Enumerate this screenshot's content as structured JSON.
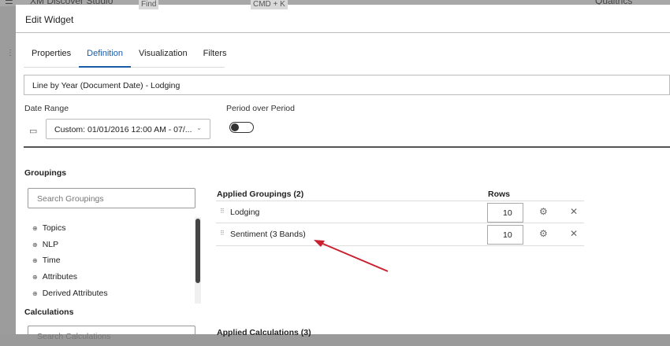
{
  "background_app": {
    "title": "XM Discover Studio",
    "find": "Find",
    "shortcut": "CMD + K",
    "org": "Qualtrics"
  },
  "modal": {
    "title": "Edit Widget",
    "tabs": [
      {
        "label": "Properties"
      },
      {
        "label": "Definition",
        "active": true
      },
      {
        "label": "Visualization"
      },
      {
        "label": "Filters"
      }
    ],
    "widget_name": "Line by Year (Document Date) - Lodging",
    "date_range": {
      "label": "Date Range",
      "value": "Custom: 01/01/2016 12:00 AM - 07/..."
    },
    "period_over_period": {
      "label": "Period over Period",
      "enabled": false
    },
    "groupings": {
      "heading": "Groupings",
      "search_placeholder": "Search Groupings",
      "tree": [
        {
          "label": "Topics"
        },
        {
          "label": "NLP"
        },
        {
          "label": "Time"
        },
        {
          "label": "Attributes"
        },
        {
          "label": "Derived Attributes"
        }
      ]
    },
    "applied_groupings": {
      "heading": "Applied Groupings (2)",
      "rows_header": "Rows",
      "items": [
        {
          "name": "Lodging",
          "rows": "10"
        },
        {
          "name": "Sentiment (3 Bands)",
          "rows": "10"
        }
      ]
    },
    "calculations": {
      "heading": "Calculations",
      "search_placeholder": "Search Calculations"
    },
    "applied_calculations": {
      "heading": "Applied Calculations (3)"
    }
  },
  "annotation": {
    "arrow_color": "#c8202f"
  }
}
